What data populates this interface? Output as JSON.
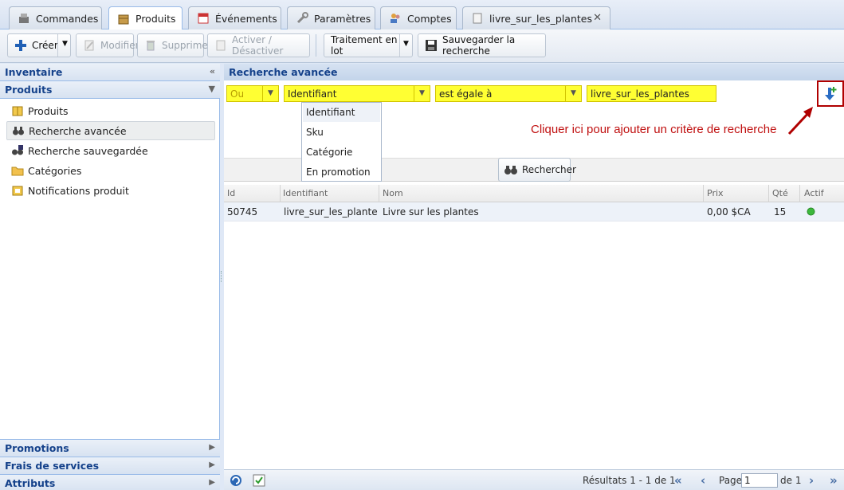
{
  "tabs": [
    {
      "label": "Commandes",
      "icon": "register-icon"
    },
    {
      "label": "Produits",
      "icon": "box-icon"
    },
    {
      "label": "Événements",
      "icon": "calendar-icon"
    },
    {
      "label": "Paramètres",
      "icon": "wrench-icon"
    },
    {
      "label": "Comptes",
      "icon": "users-icon"
    },
    {
      "label": "livre_sur_les_plantes",
      "icon": "product-icon"
    }
  ],
  "toolbar": {
    "create": "Créer",
    "modify": "Modifier",
    "delete": "Supprimer",
    "toggle": "Activer / Désactiver",
    "batch": "Traitement en lot",
    "save_search": "Sauvegarder la recherche"
  },
  "left": {
    "inventory": "Inventaire",
    "products_section": "Produits",
    "items": [
      {
        "label": "Produits",
        "icon": "box-icon"
      },
      {
        "label": "Recherche avancée",
        "icon": "binoculars-icon"
      },
      {
        "label": "Recherche sauvegardée",
        "icon": "saved-search-icon"
      },
      {
        "label": "Catégories",
        "icon": "folder-icon"
      },
      {
        "label": "Notifications produit",
        "icon": "notification-icon"
      }
    ],
    "bottom": [
      "Promotions",
      "Frais de services",
      "Attributs"
    ]
  },
  "main": {
    "title": "Recherche avancée",
    "criteria": {
      "logic": "Ou",
      "field": "Identifiant",
      "operator": "est égale à",
      "value": "livre_sur_les_plantes"
    },
    "dropdown_options": [
      "Identifiant",
      "Sku",
      "Catégorie",
      "En promotion"
    ],
    "tip": "Cliquer ici pour ajouter un critère de recherche",
    "search_button": "Rechercher"
  },
  "grid": {
    "columns": [
      "Id",
      "Identifiant",
      "Nom",
      "Prix",
      "Qté",
      "Actif"
    ],
    "rows": [
      {
        "id": "50745",
        "identifiant": "livre_sur_les_plantes",
        "nom": "Livre sur les plantes",
        "prix": "0,00 $CA",
        "qte": "15",
        "actif": true
      }
    ]
  },
  "footer": {
    "results": "Résultats 1 - 1 de 1",
    "page_label": "Page",
    "page_value": "1",
    "of_label": "de 1"
  },
  "colors": {
    "criteria_highlight": "#ffff33",
    "annotation": "#c01010",
    "active_status": "#3cb83c"
  }
}
